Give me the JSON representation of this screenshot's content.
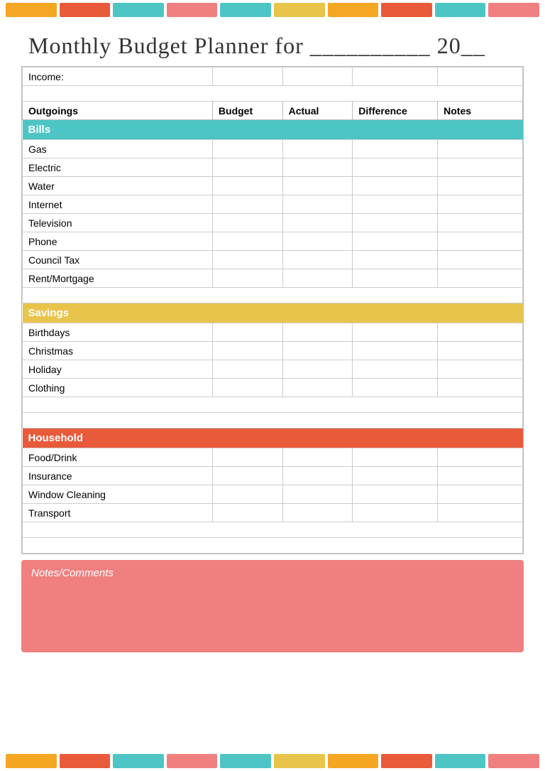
{
  "title": {
    "text": "Monthly Budget Planner for __________ 20__"
  },
  "topStrip": {
    "blocks": [
      {
        "color": "#f5a623",
        "width": 60
      },
      {
        "color": "#e85a3a",
        "width": 60
      },
      {
        "color": "#4dc5c5",
        "width": 60
      },
      {
        "color": "#f08080",
        "width": 60
      },
      {
        "color": "#4dc5c5",
        "width": 60
      },
      {
        "color": "#e8c44a",
        "width": 60
      },
      {
        "color": "#f5a623",
        "width": 60
      },
      {
        "color": "#e85a3a",
        "width": 60
      },
      {
        "color": "#4dc5c5",
        "width": 60
      },
      {
        "color": "#f08080",
        "width": 60
      }
    ]
  },
  "table": {
    "incomeLabel": "Income:",
    "headers": {
      "outgoings": "Outgoings",
      "budget": "Budget",
      "actual": "Actual",
      "difference": "Difference",
      "notes": "Notes"
    },
    "sections": {
      "bills": {
        "label": "Bills",
        "items": [
          "Gas",
          "Electric",
          "Water",
          "Internet",
          "Television",
          "Phone",
          "Council Tax",
          "Rent/Mortgage"
        ]
      },
      "savings": {
        "label": "Savings",
        "items": [
          "Birthdays",
          "Christmas",
          "Holiday",
          "Clothing"
        ]
      },
      "household": {
        "label": "Household",
        "items": [
          "Food/Drink",
          "Insurance",
          "Window Cleaning",
          "Transport"
        ]
      }
    }
  },
  "notes": {
    "label": "Notes/Comments"
  },
  "bottomStrip": {
    "blocks": [
      {
        "color": "#f5a623",
        "width": 60
      },
      {
        "color": "#e85a3a",
        "width": 60
      },
      {
        "color": "#4dc5c5",
        "width": 60
      },
      {
        "color": "#f08080",
        "width": 60
      },
      {
        "color": "#4dc5c5",
        "width": 60
      },
      {
        "color": "#e8c44a",
        "width": 60
      },
      {
        "color": "#f5a623",
        "width": 60
      },
      {
        "color": "#e85a3a",
        "width": 60
      },
      {
        "color": "#4dc5c5",
        "width": 60
      },
      {
        "color": "#f08080",
        "width": 60
      }
    ]
  }
}
